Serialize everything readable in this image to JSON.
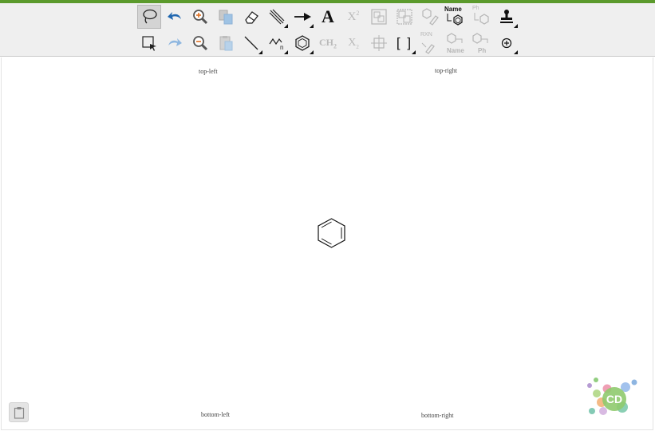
{
  "brand": {
    "accent": "#5b9a2c",
    "logo_text": "CD"
  },
  "toolbar": {
    "row1": [
      {
        "name": "lasso-tool-button",
        "icon": "lasso-icon",
        "active": true
      },
      {
        "name": "undo-button",
        "icon": "undo-icon"
      },
      {
        "name": "zoom-in-button",
        "icon": "zoom-in-icon"
      },
      {
        "name": "copy-button",
        "icon": "copy-icon",
        "disabled": true
      },
      {
        "name": "eraser-button",
        "icon": "eraser-icon"
      },
      {
        "name": "bond-tool-button",
        "icon": "bond-icon"
      },
      {
        "name": "arrow-tool-button",
        "icon": "arrow-icon"
      },
      {
        "name": "text-tool-button",
        "icon": "text-icon",
        "label": "A"
      },
      {
        "name": "superscript-button",
        "icon": "superscript-icon",
        "label": "X",
        "sup": "2",
        "disabled": true
      },
      {
        "name": "group-button",
        "icon": "group-icon",
        "disabled": true
      },
      {
        "name": "ungroup-button",
        "icon": "ungroup-icon",
        "disabled": true
      },
      {
        "name": "clean-structure-button",
        "icon": "clean-icon",
        "disabled": true
      },
      {
        "name": "name-to-structure-button",
        "icon": "name-to-structure-icon",
        "label": "Name"
      },
      {
        "name": "structure-to-name-button",
        "icon": "structure-to-name-icon",
        "label": "Ph",
        "disabled": true
      },
      {
        "name": "stamp-button",
        "icon": "stamp-icon"
      }
    ],
    "row2": [
      {
        "name": "select-tool-button",
        "icon": "select-icon"
      },
      {
        "name": "redo-button",
        "icon": "redo-icon",
        "disabled": true
      },
      {
        "name": "zoom-out-button",
        "icon": "zoom-out-icon"
      },
      {
        "name": "paste-button",
        "icon": "paste-icon",
        "disabled": true
      },
      {
        "name": "single-bond-button",
        "icon": "single-bond-icon"
      },
      {
        "name": "chain-tool-button",
        "icon": "chain-icon"
      },
      {
        "name": "ring-tool-button",
        "icon": "benzene-ring-icon"
      },
      {
        "name": "ch2-text-button",
        "icon": "ch2-icon",
        "label": "CH",
        "sub": "2",
        "disabled": true
      },
      {
        "name": "subscript-button",
        "icon": "subscript-icon",
        "label": "X",
        "sub": "2",
        "disabled": true
      },
      {
        "name": "center-button",
        "icon": "center-icon",
        "disabled": true
      },
      {
        "name": "bracket-tool-button",
        "icon": "bracket-icon",
        "label": "[ ]"
      },
      {
        "name": "clean-reaction-button",
        "icon": "clean-reaction-icon",
        "label": "RXN",
        "disabled": true
      },
      {
        "name": "show-name-button",
        "icon": "show-name-icon",
        "label": "Name",
        "disabled": true
      },
      {
        "name": "show-ph-button",
        "icon": "show-ph-icon",
        "label": "Ph",
        "disabled": true
      },
      {
        "name": "charge-button",
        "icon": "charge-plus-icon"
      }
    ]
  },
  "canvas": {
    "corners": {
      "top_left": "top-left",
      "top_right": "top-right",
      "bottom_left": "bottom-left",
      "bottom_right": "bottom-right"
    }
  }
}
